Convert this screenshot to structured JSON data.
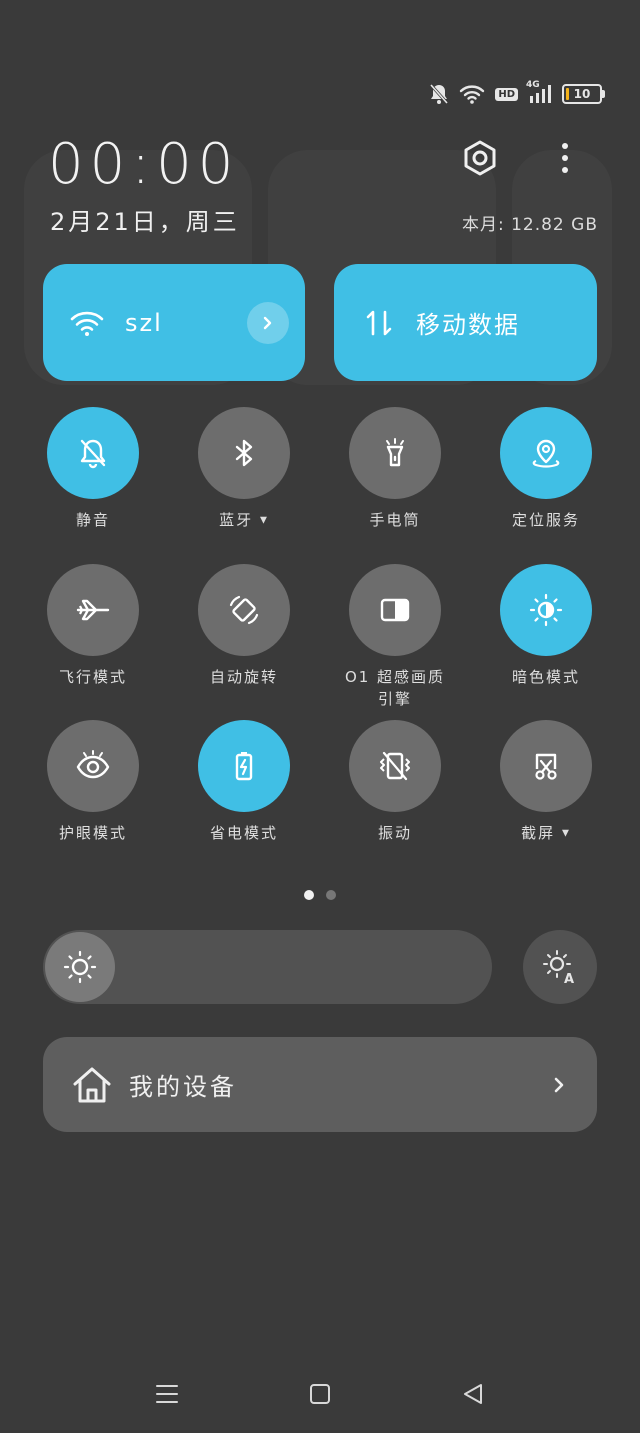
{
  "status_bar": {
    "icons": [
      "bell-off-icon",
      "wifi-icon",
      "hd-icon",
      "signal-icon",
      "battery-icon"
    ],
    "hd_label": "HD",
    "network_label": "4G",
    "battery_level": "10",
    "battery_color": "#f3b21b"
  },
  "header": {
    "time": "00:00",
    "date": "2月21日，周三",
    "data_usage": "本月: 12.82 GB",
    "settings_icon": "settings-icon",
    "more_icon": "more-vert-icon"
  },
  "big_tiles": [
    {
      "label": "szl",
      "icon": "wifi-icon",
      "active": true
    },
    {
      "label": "移动数据",
      "icon": "mobile-data-icon",
      "active": true
    }
  ],
  "toggles": [
    {
      "label": "静音",
      "icon": "bell-off-icon",
      "active": true
    },
    {
      "label": "蓝牙",
      "icon": "bluetooth-icon",
      "active": false,
      "has_menu": true
    },
    {
      "label": "手电筒",
      "icon": "flashlight-icon",
      "active": false
    },
    {
      "label": "定位服务",
      "icon": "location-icon",
      "active": true
    },
    {
      "label": "飞行模式",
      "icon": "airplane-icon",
      "active": false
    },
    {
      "label": "自动旋转",
      "icon": "rotate-icon",
      "active": false
    },
    {
      "label": "O1 超感画质引擎",
      "icon": "picture-engine-icon",
      "active": false
    },
    {
      "label": "暗色模式",
      "icon": "dark-mode-icon",
      "active": true
    },
    {
      "label": "护眼模式",
      "icon": "eye-icon",
      "active": false
    },
    {
      "label": "省电模式",
      "icon": "battery-saver-icon",
      "active": true
    },
    {
      "label": "振动",
      "icon": "vibrate-icon",
      "active": false
    },
    {
      "label": "截屏",
      "icon": "screenshot-icon",
      "active": false,
      "has_menu": true
    }
  ],
  "pager": {
    "pages": 2,
    "current": 1
  },
  "brightness": {
    "level": 0.1,
    "icon": "brightness-icon",
    "auto_icon": "auto-brightness-icon"
  },
  "devices": {
    "label": "我的设备",
    "icon": "home-icon"
  },
  "colors": {
    "accent": "#40bfe5",
    "inactive": "#6d6d6d",
    "background": "#3a3a3a"
  },
  "nav": {
    "icons": [
      "menu-icon",
      "home-button-icon",
      "back-icon"
    ]
  }
}
